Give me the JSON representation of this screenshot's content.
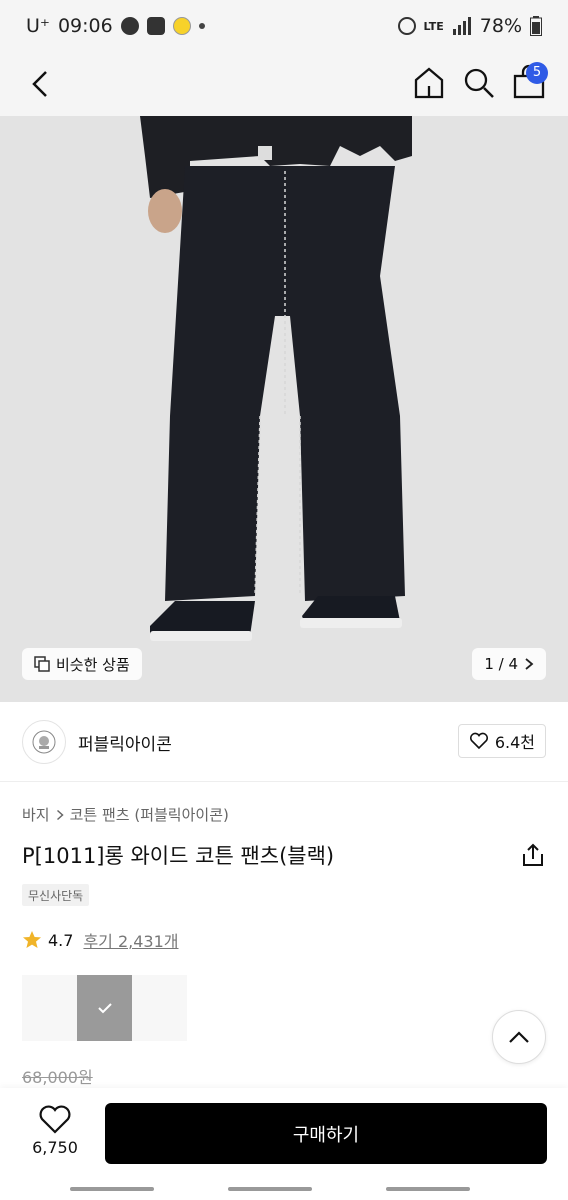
{
  "status_bar": {
    "carrier": "U⁺",
    "time": "09:06",
    "network": "LTE",
    "battery": "78%"
  },
  "header": {
    "cart_count": "5"
  },
  "gallery": {
    "similar_label": "비슷한 상품",
    "pager": "1 / 4"
  },
  "brand": {
    "name": "퍼블릭아이콘",
    "likes": "6.4천"
  },
  "breadcrumb": {
    "category": "바지",
    "sub": "코튼 팬츠 (퍼블릭아이콘)"
  },
  "product": {
    "title": "P[1011]롱 와이드 코튼 팬츠(블랙)",
    "tag": "무신사단독",
    "rating": "4.7",
    "reviews": "후기 2,431개",
    "original_price": "68,000원"
  },
  "bottom_bar": {
    "like_count": "6,750",
    "buy_label": "구매하기"
  },
  "colors": {
    "badge": "#2f5be6",
    "star": "#f0b429",
    "buy_button": "#000000"
  }
}
